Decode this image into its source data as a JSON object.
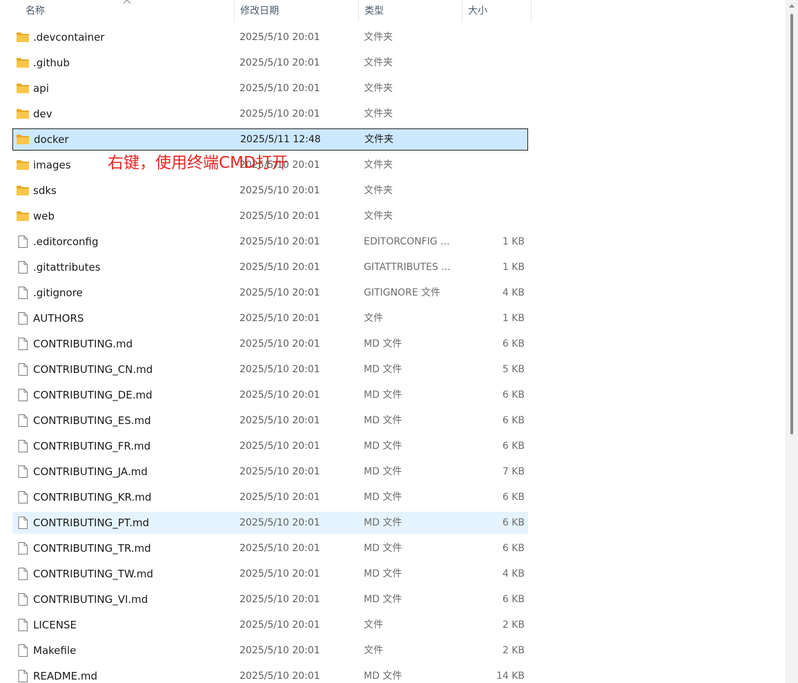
{
  "columns": {
    "name": "名称",
    "date": "修改日期",
    "type": "类型",
    "size": "大小"
  },
  "annotation": "右键，使用终端CMD打开",
  "files": [
    {
      "name": ".devcontainer",
      "date": "2025/5/10 20:01",
      "type": "文件夹",
      "size": "",
      "icon": "folder-icon"
    },
    {
      "name": ".github",
      "date": "2025/5/10 20:01",
      "type": "文件夹",
      "size": "",
      "icon": "folder-icon"
    },
    {
      "name": "api",
      "date": "2025/5/10 20:01",
      "type": "文件夹",
      "size": "",
      "icon": "folder-icon"
    },
    {
      "name": "dev",
      "date": "2025/5/10 20:01",
      "type": "文件夹",
      "size": "",
      "icon": "folder-icon"
    },
    {
      "name": "docker",
      "date": "2025/5/11 12:48",
      "type": "文件夹",
      "size": "",
      "icon": "folder-icon",
      "state": "selected"
    },
    {
      "name": "images",
      "date": "2025/5/10 20:01",
      "type": "文件夹",
      "size": "",
      "icon": "folder-icon"
    },
    {
      "name": "sdks",
      "date": "2025/5/10 20:01",
      "type": "文件夹",
      "size": "",
      "icon": "folder-icon"
    },
    {
      "name": "web",
      "date": "2025/5/10 20:01",
      "type": "文件夹",
      "size": "",
      "icon": "folder-icon"
    },
    {
      "name": ".editorconfig",
      "date": "2025/5/10 20:01",
      "type": "EDITORCONFIG ...",
      "size": "1 KB",
      "icon": "file-icon"
    },
    {
      "name": ".gitattributes",
      "date": "2025/5/10 20:01",
      "type": "GITATTRIBUTES ...",
      "size": "1 KB",
      "icon": "file-icon"
    },
    {
      "name": ".gitignore",
      "date": "2025/5/10 20:01",
      "type": "GITIGNORE 文件",
      "size": "4 KB",
      "icon": "file-icon"
    },
    {
      "name": "AUTHORS",
      "date": "2025/5/10 20:01",
      "type": "文件",
      "size": "1 KB",
      "icon": "file-icon"
    },
    {
      "name": "CONTRIBUTING.md",
      "date": "2025/5/10 20:01",
      "type": "MD 文件",
      "size": "6 KB",
      "icon": "file-icon"
    },
    {
      "name": "CONTRIBUTING_CN.md",
      "date": "2025/5/10 20:01",
      "type": "MD 文件",
      "size": "5 KB",
      "icon": "file-icon"
    },
    {
      "name": "CONTRIBUTING_DE.md",
      "date": "2025/5/10 20:01",
      "type": "MD 文件",
      "size": "6 KB",
      "icon": "file-icon"
    },
    {
      "name": "CONTRIBUTING_ES.md",
      "date": "2025/5/10 20:01",
      "type": "MD 文件",
      "size": "6 KB",
      "icon": "file-icon"
    },
    {
      "name": "CONTRIBUTING_FR.md",
      "date": "2025/5/10 20:01",
      "type": "MD 文件",
      "size": "6 KB",
      "icon": "file-icon"
    },
    {
      "name": "CONTRIBUTING_JA.md",
      "date": "2025/5/10 20:01",
      "type": "MD 文件",
      "size": "7 KB",
      "icon": "file-icon"
    },
    {
      "name": "CONTRIBUTING_KR.md",
      "date": "2025/5/10 20:01",
      "type": "MD 文件",
      "size": "6 KB",
      "icon": "file-icon"
    },
    {
      "name": "CONTRIBUTING_PT.md",
      "date": "2025/5/10 20:01",
      "type": "MD 文件",
      "size": "6 KB",
      "icon": "file-icon",
      "state": "hover"
    },
    {
      "name": "CONTRIBUTING_TR.md",
      "date": "2025/5/10 20:01",
      "type": "MD 文件",
      "size": "6 KB",
      "icon": "file-icon"
    },
    {
      "name": "CONTRIBUTING_TW.md",
      "date": "2025/5/10 20:01",
      "type": "MD 文件",
      "size": "4 KB",
      "icon": "file-icon"
    },
    {
      "name": "CONTRIBUTING_VI.md",
      "date": "2025/5/10 20:01",
      "type": "MD 文件",
      "size": "6 KB",
      "icon": "file-icon"
    },
    {
      "name": "LICENSE",
      "date": "2025/5/10 20:01",
      "type": "文件",
      "size": "2 KB",
      "icon": "file-icon"
    },
    {
      "name": "Makefile",
      "date": "2025/5/10 20:01",
      "type": "文件",
      "size": "2 KB",
      "icon": "file-icon"
    },
    {
      "name": "README.md",
      "date": "2025/5/10 20:01",
      "type": "MD 文件",
      "size": "14 KB",
      "icon": "file-icon"
    }
  ],
  "colors": {
    "selected_bg": "#cce8ff",
    "hover_bg": "#e5f3ff",
    "annotation": "#e8231f",
    "folder": "#f8c74a"
  }
}
